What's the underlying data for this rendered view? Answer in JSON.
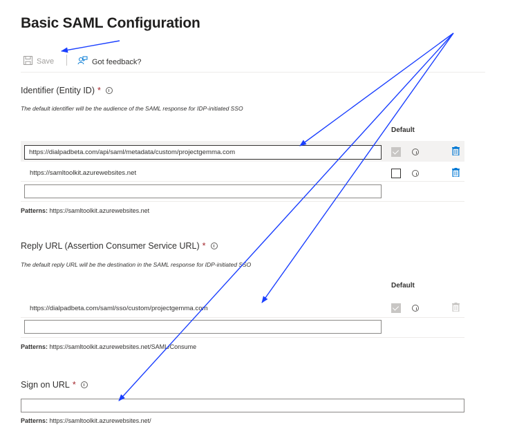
{
  "page": {
    "title": "Basic SAML Configuration"
  },
  "toolbar": {
    "save_label": "Save",
    "feedback_label": "Got feedback?"
  },
  "identifier": {
    "label": "Identifier (Entity ID)",
    "required_mark": "*",
    "description": "The default identifier will be the audience of the SAML response for IDP-initiated SSO",
    "default_header": "Default",
    "rows": [
      {
        "value": "https://dialpadbeta.com/api/saml/metadata/custom/projectgemma.com",
        "default_checked": true
      },
      {
        "value": "https://samltoolkit.azurewebsites.net",
        "default_checked": false
      }
    ],
    "new_value": "",
    "patterns_label": "Patterns:",
    "patterns_value": "https://samltoolkit.azurewebsites.net"
  },
  "reply": {
    "label": "Reply URL (Assertion Consumer Service URL)",
    "required_mark": "*",
    "description": "The default reply URL will be the destination in the SAML response for IDP-initiated SSO",
    "default_header": "Default",
    "rows": [
      {
        "value": "https://dialpadbeta.com/saml/sso/custom/projectgemma.com",
        "default_checked": true
      }
    ],
    "new_value": "",
    "patterns_label": "Patterns:",
    "patterns_value": "https://samltoolkit.azurewebsites.net/SAML/Consume"
  },
  "signon": {
    "label": "Sign on URL",
    "required_mark": "*",
    "value": "",
    "patterns_label": "Patterns:",
    "patterns_value": "https://samltoolkit.azurewebsites.net/"
  },
  "colors": {
    "accent": "#0078d4",
    "annotation_arrow": "#1a3fff",
    "required": "#a4262c"
  },
  "icons": [
    "save-icon",
    "feedback-icon",
    "info-icon",
    "delete-icon",
    "checkbox"
  ]
}
